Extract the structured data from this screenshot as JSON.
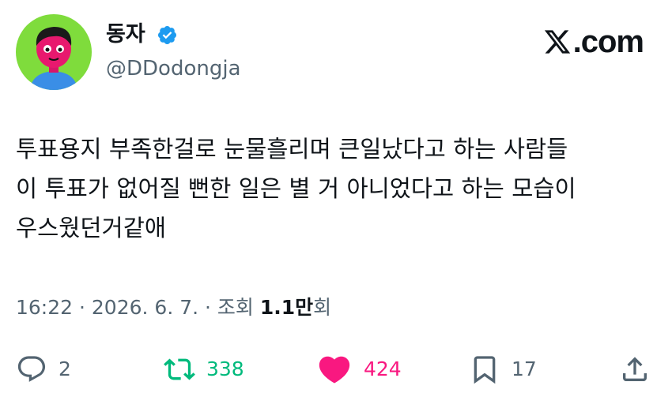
{
  "author": {
    "display_name": "동자",
    "handle": "@DDodongja",
    "verified": true
  },
  "brand": {
    "domain": ".com",
    "logo_icon": "x-logo-icon"
  },
  "tweet": {
    "lines": [
      "투표용지 부족한걸로 눈물흘리며 큰일났다고 하는 사람들",
      "이 투표가 없어질 뻔한 일은 별 거 아니었다고 하는 모습이",
      "우스웠던거같애"
    ]
  },
  "meta": {
    "time": "16:22",
    "sep1": " · ",
    "date": "2026. 6. 7.",
    "sep2": " · ",
    "views_prefix": "조회 ",
    "views_count": "1.1만",
    "views_suffix": "회"
  },
  "actions": {
    "reply_count": "2",
    "retweet_count": "338",
    "like_count": "424",
    "bookmark_count": "17"
  },
  "colors": {
    "verified": "#1d9bf0",
    "retweet": "#00ba7c",
    "like": "#f91880",
    "muted": "#536471",
    "avatar_bg": "#7fdc3c",
    "avatar_face": "#e8196e",
    "avatar_shirt": "#3a8ee6"
  }
}
